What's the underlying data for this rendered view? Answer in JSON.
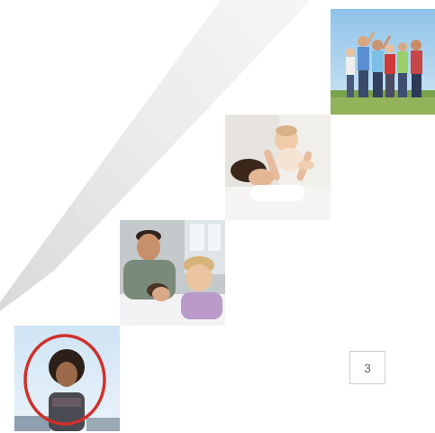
{
  "page": {
    "number": "3"
  },
  "photos": [
    {
      "id": "photo-group",
      "subject": "group-of-kids-outdoors"
    },
    {
      "id": "photo-baby",
      "subject": "mother-lifting-baby"
    },
    {
      "id": "photo-family",
      "subject": "father-and-children-lying"
    },
    {
      "id": "photo-girl",
      "subject": "girl-with-hoop"
    }
  ],
  "colors": {
    "swoosh_light": "#f1f1f2",
    "swoosh_dark": "#dcdcde",
    "page_border": "#cfcfcf",
    "page_text": "#666666"
  }
}
